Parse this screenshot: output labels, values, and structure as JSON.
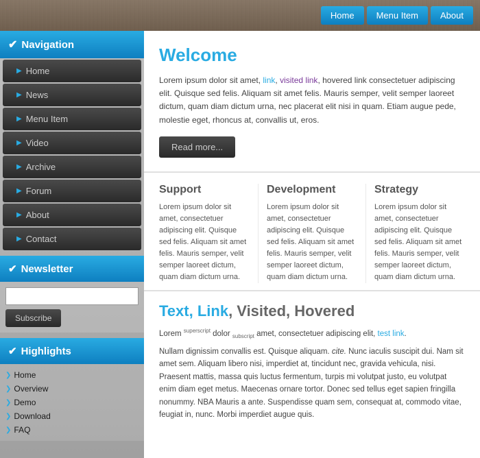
{
  "topnav": {
    "buttons": [
      {
        "id": "home",
        "label": "Home"
      },
      {
        "id": "menu-item",
        "label": "Menu Item"
      },
      {
        "id": "about",
        "label": "About"
      }
    ]
  },
  "sidebar": {
    "nav_header": "Navigation",
    "nav_items": [
      {
        "id": "home",
        "label": "Home"
      },
      {
        "id": "news",
        "label": "News"
      },
      {
        "id": "menu-item",
        "label": "Menu Item"
      },
      {
        "id": "video",
        "label": "Video"
      },
      {
        "id": "archive",
        "label": "Archive"
      },
      {
        "id": "forum",
        "label": "Forum"
      },
      {
        "id": "about",
        "label": "About"
      },
      {
        "id": "contact",
        "label": "Contact"
      }
    ],
    "newsletter_header": "Newsletter",
    "subscribe_label": "Subscribe",
    "highlights_header": "Highlights",
    "highlight_items": [
      {
        "id": "hl-home",
        "label": "Home"
      },
      {
        "id": "hl-overview",
        "label": "Overview"
      },
      {
        "id": "hl-demo",
        "label": "Demo"
      },
      {
        "id": "hl-download",
        "label": "Download"
      },
      {
        "id": "hl-faq",
        "label": "FAQ"
      }
    ]
  },
  "main": {
    "welcome": {
      "title": "Welcome",
      "body": "Lorem ipsum dolor sit amet,",
      "link_text": "link",
      "visited_text": "visited link",
      "body2": ", hovered link consectetuer adipiscing elit. Quisque sed felis. Aliquam sit amet felis. Mauris semper, velit semper laoreet dictum, quam diam dictum urna, nec placerat elit nisi in quam. Etiam augue pede, molestie eget, rhoncus at, convallis ut, eros.",
      "read_more_label": "Read more..."
    },
    "columns": [
      {
        "id": "support",
        "title": "Support",
        "text": "Lorem ipsum dolor sit amet, consectetuer adipiscing elit. Quisque sed felis. Aliquam sit amet felis. Mauris semper, velit semper laoreet dictum, quam diam dictum urna."
      },
      {
        "id": "development",
        "title": "Development",
        "text": "Lorem ipsum dolor sit amet, consectetuer adipiscing elit. Quisque sed felis. Aliquam sit amet felis. Mauris semper, velit semper laoreet dictum, quam diam dictum urna."
      },
      {
        "id": "strategy",
        "title": "Strategy",
        "text": "Lorem ipsum dolor sit amet, consectetuer adipiscing elit. Quisque sed felis. Aliquam sit amet felis. Mauris semper, velit semper laoreet dictum, quam diam dictum urna."
      }
    ],
    "text_link": {
      "title_part1": "Text, ",
      "title_link": "Link",
      "title_part2": ", Visited, Hovered",
      "superscript": "superscript",
      "subscript": "subscript",
      "test_link": "test link",
      "body1": "Lorem dolor amet, consectetuer adipiscing elit,",
      "body2": "Nullam dignissim convallis est. Quisque aliquam.",
      "body3_italic": "cite.",
      "body3": "Nunc iaculis suscipit dui. Nam sit amet sem. Aliquam libero nisi, imperdiet at, tincidunt nec, gravida vehicula, nisi. Praesent mattis, massa quis luctus fermentum, turpis mi volutpat justo, eu volutpat enim diam eget metus. Maecenas ornare tortor. Donec sed tellus eget sapien fringilla nonummy. NBA Mauris a ante. Suspendisse quam sem, consequat at, commodo vitae, feugiat in, nunc. Morbi imperdiet augue quis."
    }
  }
}
